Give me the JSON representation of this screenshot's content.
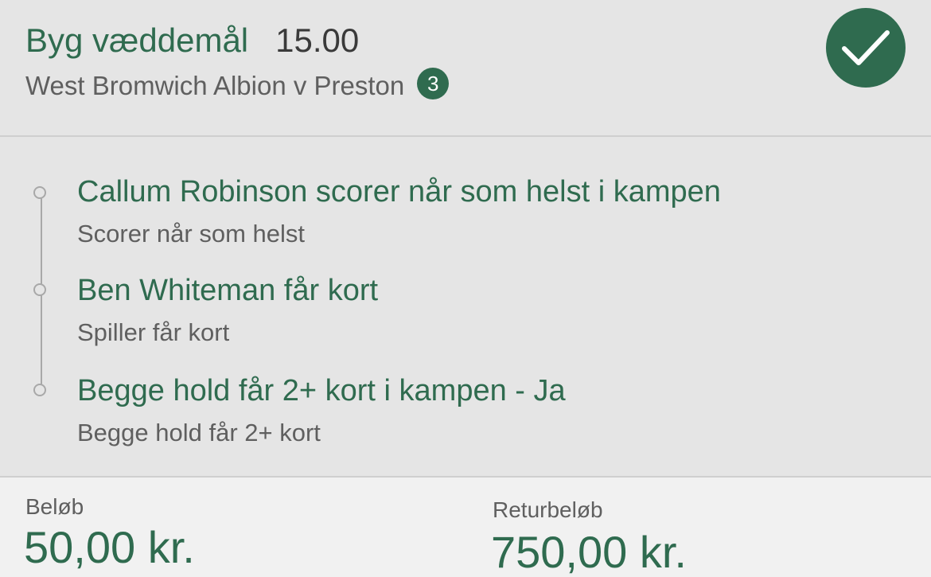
{
  "header": {
    "title": "Byg væddemål",
    "odds": "15.00",
    "match": "West Bromwich Albion v Preston",
    "selection_count": "3",
    "confirm_icon": "checkmark-icon",
    "accent_color": "#2f6b4f"
  },
  "legs": [
    {
      "title": "Callum Robinson scorer når som helst i kampen",
      "subtitle": "Scorer når som helst"
    },
    {
      "title": "Ben Whiteman får kort",
      "subtitle": "Spiller får kort"
    },
    {
      "title": "Begge hold får 2+ kort i kampen - Ja",
      "subtitle": "Begge hold får 2+ kort"
    }
  ],
  "footer": {
    "stake_label": "Beløb",
    "stake_value": "50,00 kr.",
    "return_label": "Returbeløb",
    "return_value": "750,00 kr."
  }
}
